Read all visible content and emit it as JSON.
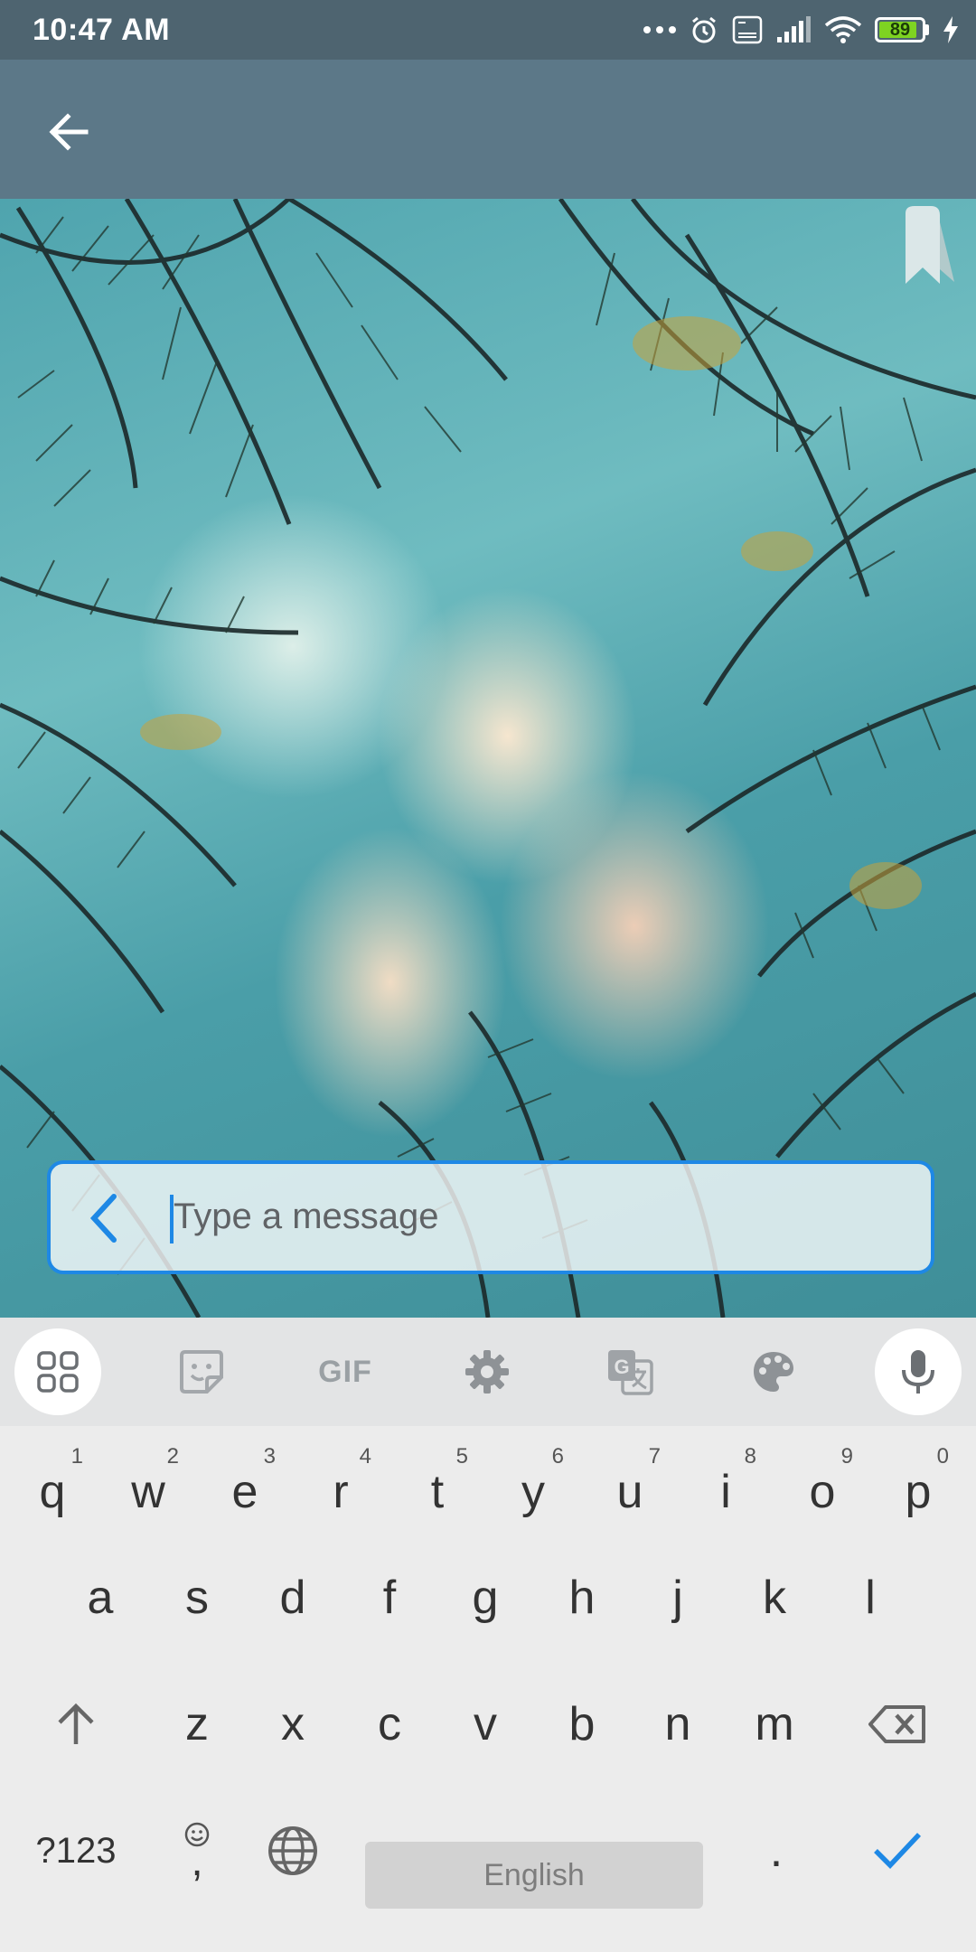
{
  "status_bar": {
    "time": "10:47 AM",
    "battery": "89",
    "battery_level": 0.89
  },
  "app_bar": {
    "back_icon": "arrow-back-icon"
  },
  "message_field": {
    "placeholder": "Type a message",
    "chevron_icon": "chevron-left-icon"
  },
  "keyboard": {
    "toolbar": [
      {
        "name": "apps-grid-button",
        "icon": "grid-icon"
      },
      {
        "name": "sticker-button",
        "icon": "sticker-icon"
      },
      {
        "name": "gif-button",
        "label": "GIF"
      },
      {
        "name": "settings-button",
        "icon": "gear-icon"
      },
      {
        "name": "translate-button",
        "icon": "translate-icon"
      },
      {
        "name": "theme-button",
        "icon": "palette-icon"
      },
      {
        "name": "voice-input-button",
        "icon": "microphone-icon"
      }
    ],
    "row1": [
      {
        "key": "q",
        "hint": "1"
      },
      {
        "key": "w",
        "hint": "2"
      },
      {
        "key": "e",
        "hint": "3"
      },
      {
        "key": "r",
        "hint": "4"
      },
      {
        "key": "t",
        "hint": "5"
      },
      {
        "key": "y",
        "hint": "6"
      },
      {
        "key": "u",
        "hint": "7"
      },
      {
        "key": "i",
        "hint": "8"
      },
      {
        "key": "o",
        "hint": "9"
      },
      {
        "key": "p",
        "hint": "0"
      }
    ],
    "row2": [
      "a",
      "s",
      "d",
      "f",
      "g",
      "h",
      "j",
      "k",
      "l"
    ],
    "row3": [
      "z",
      "x",
      "c",
      "v",
      "b",
      "n",
      "m"
    ],
    "symbols_label": "?123",
    "comma_label": ",",
    "space_label": "English",
    "period_label": ".",
    "accent_color": "#1e88e5"
  }
}
